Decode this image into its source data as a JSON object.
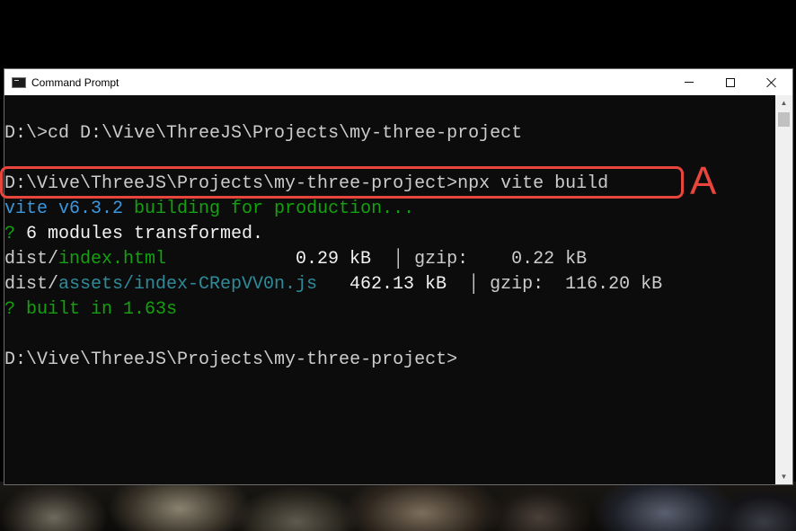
{
  "window": {
    "title": "Command Prompt",
    "controls": {
      "minimize_icon": "minimize-icon",
      "maximize_icon": "maximize-icon",
      "close_icon": "close-icon"
    }
  },
  "console": {
    "lines": [
      {
        "prompt": "D:\\>",
        "command": "cd D:\\Vive\\ThreeJS\\Projects\\my-three-project"
      },
      {
        "prompt": "D:\\Vive\\ThreeJS\\Projects\\my-three-project>",
        "command": "npx vite build"
      },
      {
        "building_prefix": "vite v6.3.2",
        "building_suffix": " building for production..."
      },
      {
        "glyph": "?",
        "text": " 6 modules transformed."
      },
      {
        "dir": "dist/",
        "file": "index.html",
        "size": "0.29 kB",
        "sep": "│",
        "gzip_label": "gzip:",
        "gzip_size": "0.22 kB"
      },
      {
        "dir": "dist/",
        "file": "assets/index-CRepVV0n.js",
        "size": "462.13 kB",
        "sep": "│",
        "gzip_label": "gzip:",
        "gzip_size": "116.20 kB"
      },
      {
        "glyph": "?",
        "text": " built in 1.63s"
      },
      {
        "prompt": "D:\\Vive\\ThreeJS\\Projects\\my-three-project>"
      }
    ]
  },
  "annotation": {
    "label": "A",
    "color": "#e8453c"
  },
  "colors": {
    "console_bg": "#0c0c0c",
    "console_text": "#cccccc",
    "vite_cyan": "#3a96dd",
    "file_teal": "#2e8b9a",
    "success_green": "#13a10e"
  }
}
